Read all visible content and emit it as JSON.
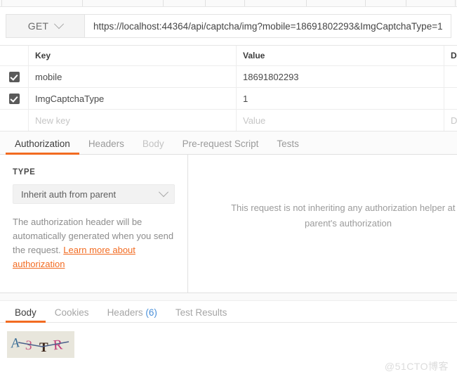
{
  "request": {
    "method": "GET",
    "method_icon": "chevron-down-icon",
    "url": "https://localhost:44364/api/captcha/img?mobile=18691802293&ImgCaptchaType=1"
  },
  "params_table": {
    "headers": {
      "key": "Key",
      "value": "Value",
      "description": "D"
    },
    "rows": [
      {
        "checked": true,
        "key": "mobile",
        "value": "18691802293",
        "description": ""
      },
      {
        "checked": true,
        "key": "ImgCaptchaType",
        "value": "1",
        "description": ""
      },
      {
        "checked": false,
        "key": "New key",
        "value": "Value",
        "description": "D"
      }
    ]
  },
  "request_tabs": [
    {
      "label": "Authorization",
      "state": "active"
    },
    {
      "label": "Headers",
      "state": "normal"
    },
    {
      "label": "Body",
      "state": "dim"
    },
    {
      "label": "Pre-request Script",
      "state": "normal"
    },
    {
      "label": "Tests",
      "state": "normal"
    }
  ],
  "authorization": {
    "type_label": "TYPE",
    "type_value": "Inherit auth from parent",
    "type_icon": "chevron-down-icon",
    "helper_text_1": "The authorization header will be automatically generated when you send the request. ",
    "helper_link": "Learn more about authorization",
    "notice_line_1": "This request is not inheriting any authorization helper at th",
    "notice_line_2": "parent's authorization"
  },
  "response_tabs": [
    {
      "label": "Body",
      "count": "",
      "state": "active"
    },
    {
      "label": "Cookies",
      "count": "",
      "state": "normal"
    },
    {
      "label": "Headers",
      "count": "(6)",
      "state": "normal"
    },
    {
      "label": "Test Results",
      "count": "",
      "state": "normal"
    }
  ],
  "response_body": {
    "captcha_text": "A3TR",
    "captcha_chars": [
      {
        "char": "A",
        "color": "#3a6e96"
      },
      {
        "char": "3",
        "color": "#c8537f"
      },
      {
        "char": "T",
        "color": "#3a2418"
      },
      {
        "char": "R",
        "color": "#c23b7a"
      }
    ],
    "captcha_bg": "#e8e6dc",
    "captcha_line_color": "#4a5f8a"
  },
  "watermark": "@51CTO博客",
  "colors": {
    "accent": "#f26b21",
    "link_blue": "#4a90d9",
    "border": "#e6e6e6",
    "checkbox": "#5a5a5a"
  }
}
